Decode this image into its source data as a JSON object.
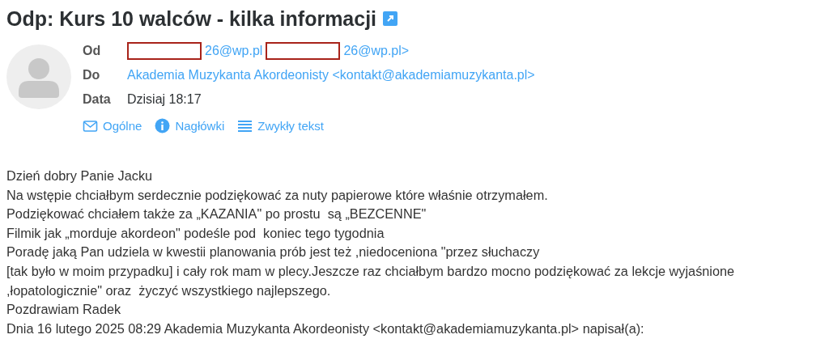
{
  "subject": "Odp: Kurs 10 walców - kilka informacji",
  "fields": [
    {
      "label": "Od",
      "kind": "redacted",
      "parts": [
        "26@wp.pl",
        "26@wp.pl>"
      ]
    },
    {
      "label": "Do",
      "kind": "link",
      "value": "Akademia Muzykanta Akordeonisty <kontakt@akademiamuzykanta.pl>"
    },
    {
      "label": "Data",
      "kind": "plain",
      "value": "Dzisiaj 18:17"
    }
  ],
  "view_links": [
    "Ogólne",
    "Nagłówki",
    "Zwykły tekst"
  ],
  "body": [
    "Dzień dobry Panie Jacku",
    "Na wstępie chciałbym serdecznie podziękować za nuty papierowe które właśnie otrzymałem.",
    "Podziękować chciałem także za „KAZANIA\" po prostu  są „BEZCENNE\"",
    "Filmik jak „morduje akordeon\" podeśle pod  koniec tego tygodnia",
    "Poradę jaką Pan udziela w kwestii planowania prób jest też ,niedoceniona \"przez słuchaczy",
    "[tak było w moim przypadku] i cały rok mam w plecy.Jeszcze raz chciałbym bardzo mocno podziękować za lekcje wyjaśnione",
    ",łopatologicznie\" oraz  życzyć wszystkiego najlepszego.",
    "Pozdrawiam Radek",
    "Dnia 16 lutego 2025 08:29 Akademia Muzykanta Akordeonisty <kontakt@akademiamuzykanta.pl> napisał(a):"
  ]
}
